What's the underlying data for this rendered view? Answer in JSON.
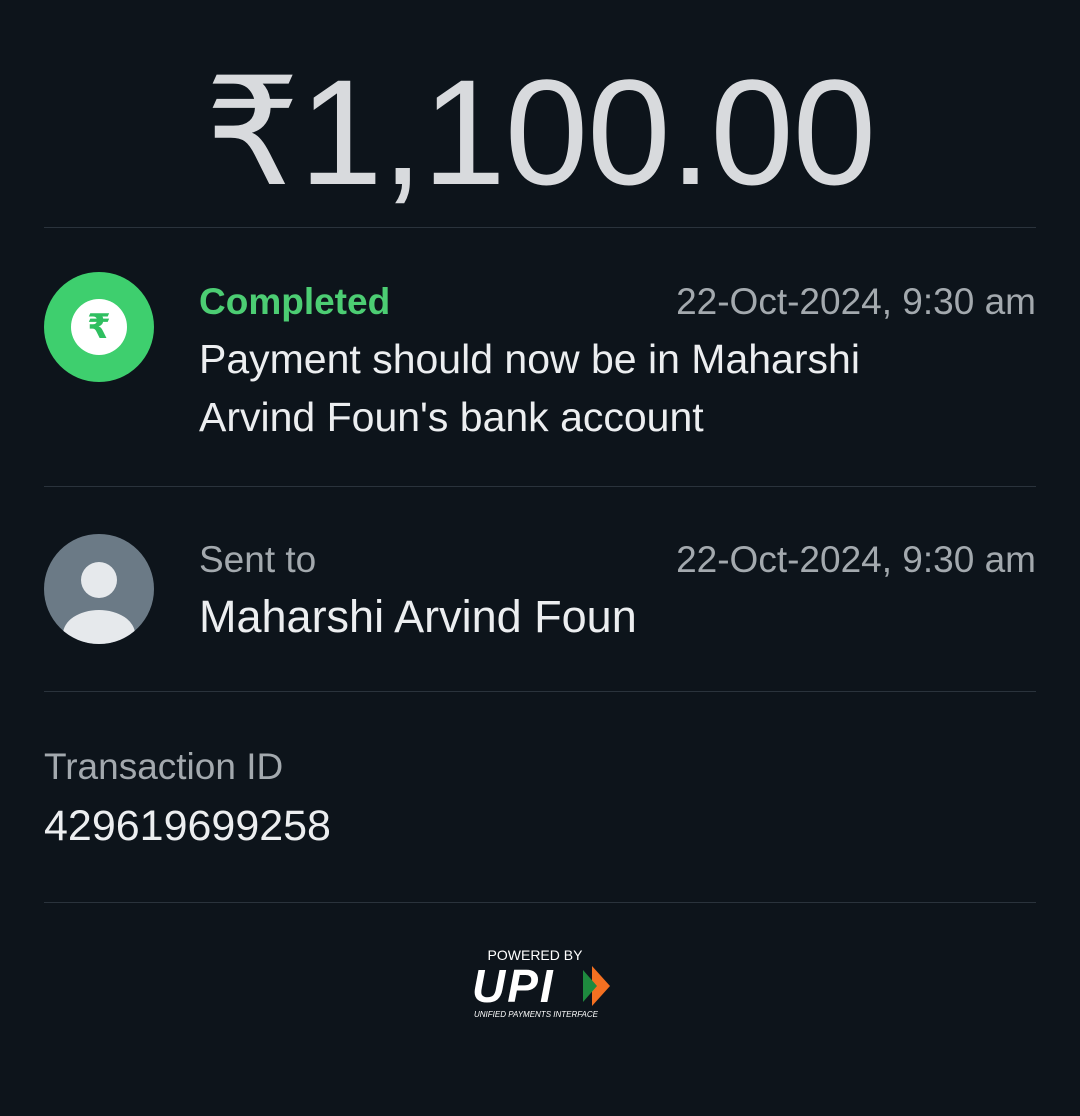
{
  "payment": {
    "amount": "₹1,100.00"
  },
  "status": {
    "label": "Completed",
    "timestamp": "22-Oct-2024, 9:30 am",
    "message": "Payment should now be in Maharshi Arvind Foun's bank account",
    "icon": "rupee-icon",
    "color": "#3ecf6e"
  },
  "recipient": {
    "label": "Sent to",
    "timestamp": "22-Oct-2024, 9:30 am",
    "name": "Maharshi Arvind Foun",
    "icon": "person-icon"
  },
  "transaction": {
    "label": "Transaction ID",
    "id": "429619699258"
  },
  "footer": {
    "powered_by": "POWERED BY",
    "upi_text": "UPI",
    "upi_tagline": "UNIFIED PAYMENTS INTERFACE"
  }
}
